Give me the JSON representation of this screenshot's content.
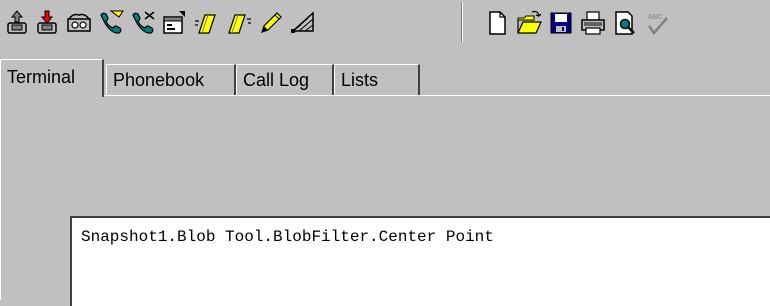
{
  "toolbar": {
    "buttons": [
      {
        "icon": "upload-phone-icon",
        "label": ""
      },
      {
        "icon": "download-phone-icon",
        "label": ""
      },
      {
        "icon": "answering-machine-icon",
        "label": ""
      },
      {
        "icon": "handset-connect-icon",
        "label": ""
      },
      {
        "icon": "handset-disconnect-icon",
        "label": ""
      },
      {
        "icon": "properties-icon",
        "label": ""
      },
      {
        "icon": "send-file-icon",
        "label": ""
      },
      {
        "icon": "receive-file-icon",
        "label": ""
      },
      {
        "icon": "pencil-icon",
        "label": ""
      },
      {
        "icon": "network-icon",
        "label": ""
      },
      {
        "icon": "new-document-icon",
        "label": ""
      },
      {
        "icon": "open-folder-icon",
        "label": ""
      },
      {
        "icon": "save-icon",
        "label": ""
      },
      {
        "icon": "print-icon",
        "label": ""
      },
      {
        "icon": "print-preview-icon",
        "label": ""
      },
      {
        "icon": "spell-check-icon",
        "label": ""
      }
    ],
    "spell_check_text": "ABC"
  },
  "tabs": [
    {
      "label": "Terminal",
      "active": true
    },
    {
      "label": "Phonebook",
      "active": false
    },
    {
      "label": "Call Log",
      "active": false
    },
    {
      "label": "Lists",
      "active": false
    }
  ],
  "terminal": {
    "output_line": "Snapshot1.Blob Tool.BlobFilter.Center Point"
  },
  "colors": {
    "face": "#c0c0c0",
    "highlight": "#ffffff",
    "shadow": "#808080",
    "dark_shadow": "#404040",
    "teal": "#008080",
    "red": "#ff0000",
    "navy": "#000080",
    "yellow": "#ffff00"
  }
}
